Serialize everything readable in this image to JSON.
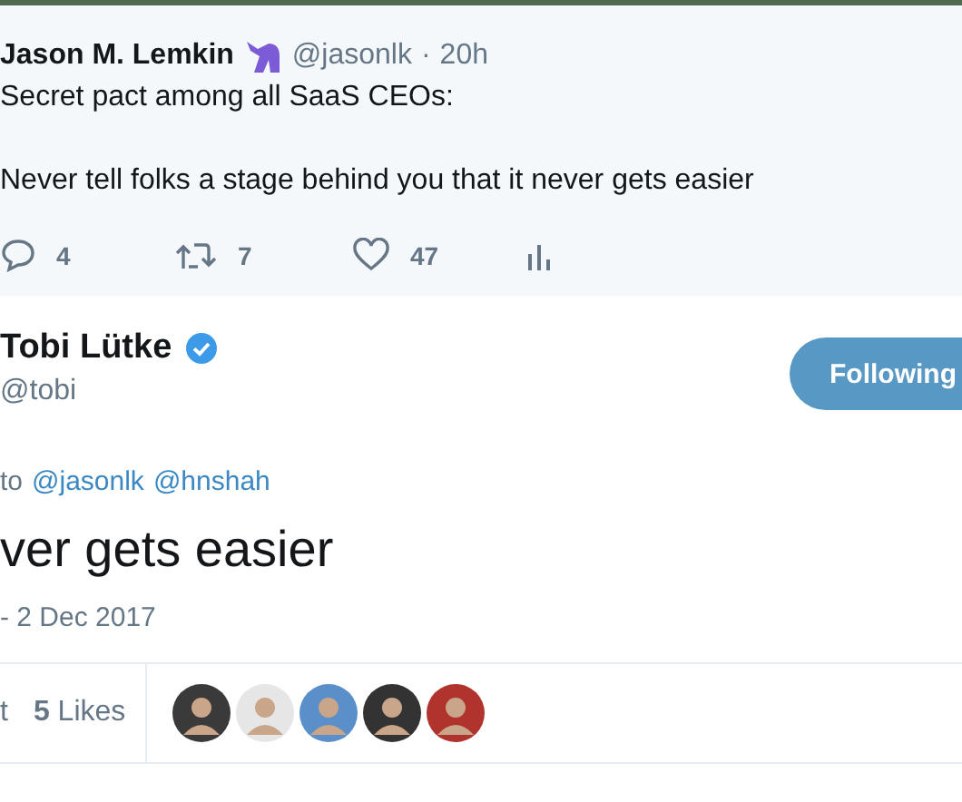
{
  "parent_tweet": {
    "name": "Jason M. Lemkin",
    "handle": "@jasonlk",
    "separator": "·",
    "time": "20h",
    "lines": [
      "Secret pact among all SaaS CEOs:",
      "Never tell folks a stage behind you that it never gets easier"
    ],
    "actions": [
      {
        "kind": "reply",
        "count": "4"
      },
      {
        "kind": "retweet",
        "count": "7"
      },
      {
        "kind": "like",
        "count": "47"
      },
      {
        "kind": "analytics"
      }
    ]
  },
  "tweet": {
    "name": "Tobi Lütke",
    "verified": true,
    "handle": "@tobi",
    "follow_button": "Following",
    "reply_to": {
      "prefix": "to",
      "mentions": [
        "@jasonlk",
        "@hnshah"
      ]
    },
    "text": "ver gets easier",
    "date": "- 2 Dec 2017",
    "stats": [
      {
        "label": "t"
      },
      {
        "label": "**5** Likes"
      }
    ],
    "likers": [
      {
        "kind": "avatar"
      },
      {
        "kind": "avatar"
      },
      {
        "kind": "avatar"
      },
      {
        "kind": "avatar"
      },
      {
        "kind": "avatar"
      }
    ]
  }
}
